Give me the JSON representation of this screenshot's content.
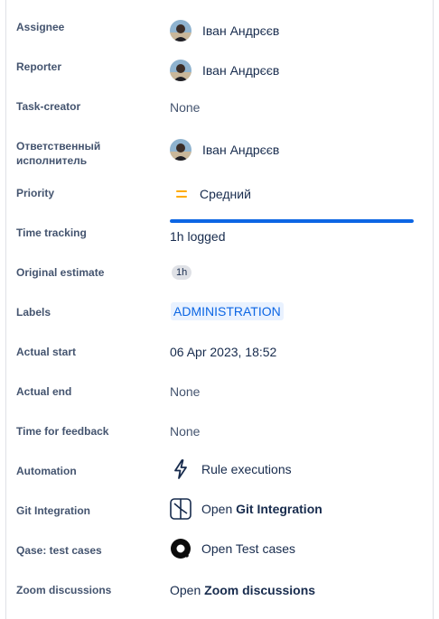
{
  "fields": {
    "assignee": {
      "label": "Assignee",
      "value": "Іван Андрєєв"
    },
    "reporter": {
      "label": "Reporter",
      "value": "Іван Андрєєв"
    },
    "task_creator": {
      "label": "Task-creator",
      "value": "None"
    },
    "responsible": {
      "label": "Ответственный исполнитель",
      "value": "Іван Андрєєв"
    },
    "priority": {
      "label": "Priority",
      "value": "Средний",
      "icon": "priority-medium-icon",
      "color": "#FFAB00"
    },
    "time_tracking": {
      "label": "Time tracking",
      "logged_text": "1h logged",
      "progress": 1.0
    },
    "original_estimate": {
      "label": "Original estimate",
      "value": "1h"
    },
    "labels": {
      "label": "Labels",
      "values": [
        "ADMINISTRATION"
      ]
    },
    "actual_start": {
      "label": "Actual start",
      "value": "06 Apr 2023, 18:52"
    },
    "actual_end": {
      "label": "Actual end",
      "value": "None"
    },
    "time_for_feedback": {
      "label": "Time for feedback",
      "value": "None"
    },
    "automation": {
      "label": "Automation",
      "value": "Rule executions",
      "icon": "lightning-icon"
    },
    "git_integration": {
      "label": "Git Integration",
      "prefix": "Open ",
      "bold": "Git Integration",
      "icon": "git-integration-icon"
    },
    "qase": {
      "label": "Qase: test cases",
      "value": "Open Test cases",
      "icon": "qase-icon"
    },
    "zoom": {
      "label": "Zoom discussions",
      "prefix": "Open ",
      "bold": "Zoom discussions"
    }
  },
  "colors": {
    "accent": "#0C66E4",
    "label_bg": "#E9F2FF",
    "priority": "#FFAB00"
  }
}
